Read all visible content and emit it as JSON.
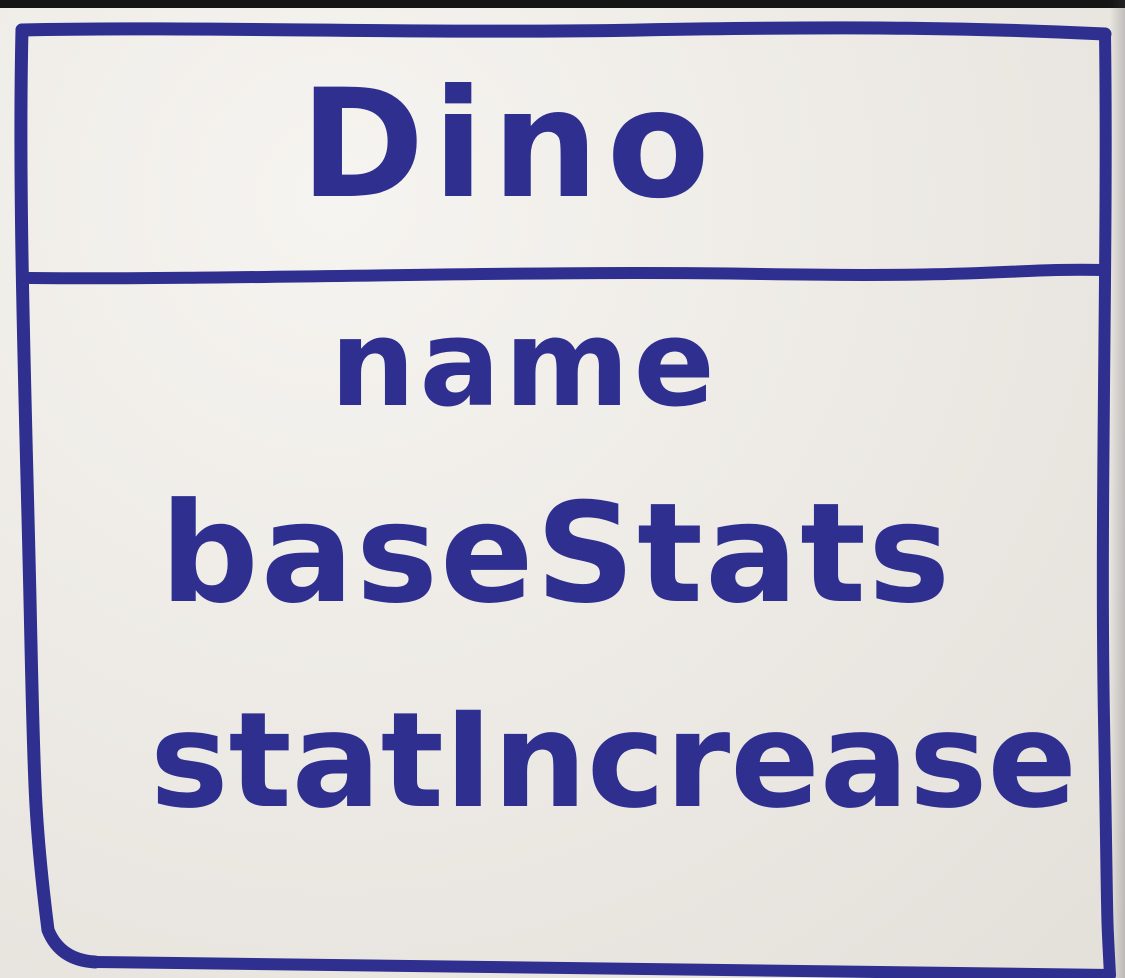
{
  "diagram": {
    "class_name": "Dino",
    "attributes": [
      "name",
      "baseStats",
      "statIncrease"
    ],
    "ink_color": "#2e2f8f",
    "paper_color": "#efede9"
  }
}
